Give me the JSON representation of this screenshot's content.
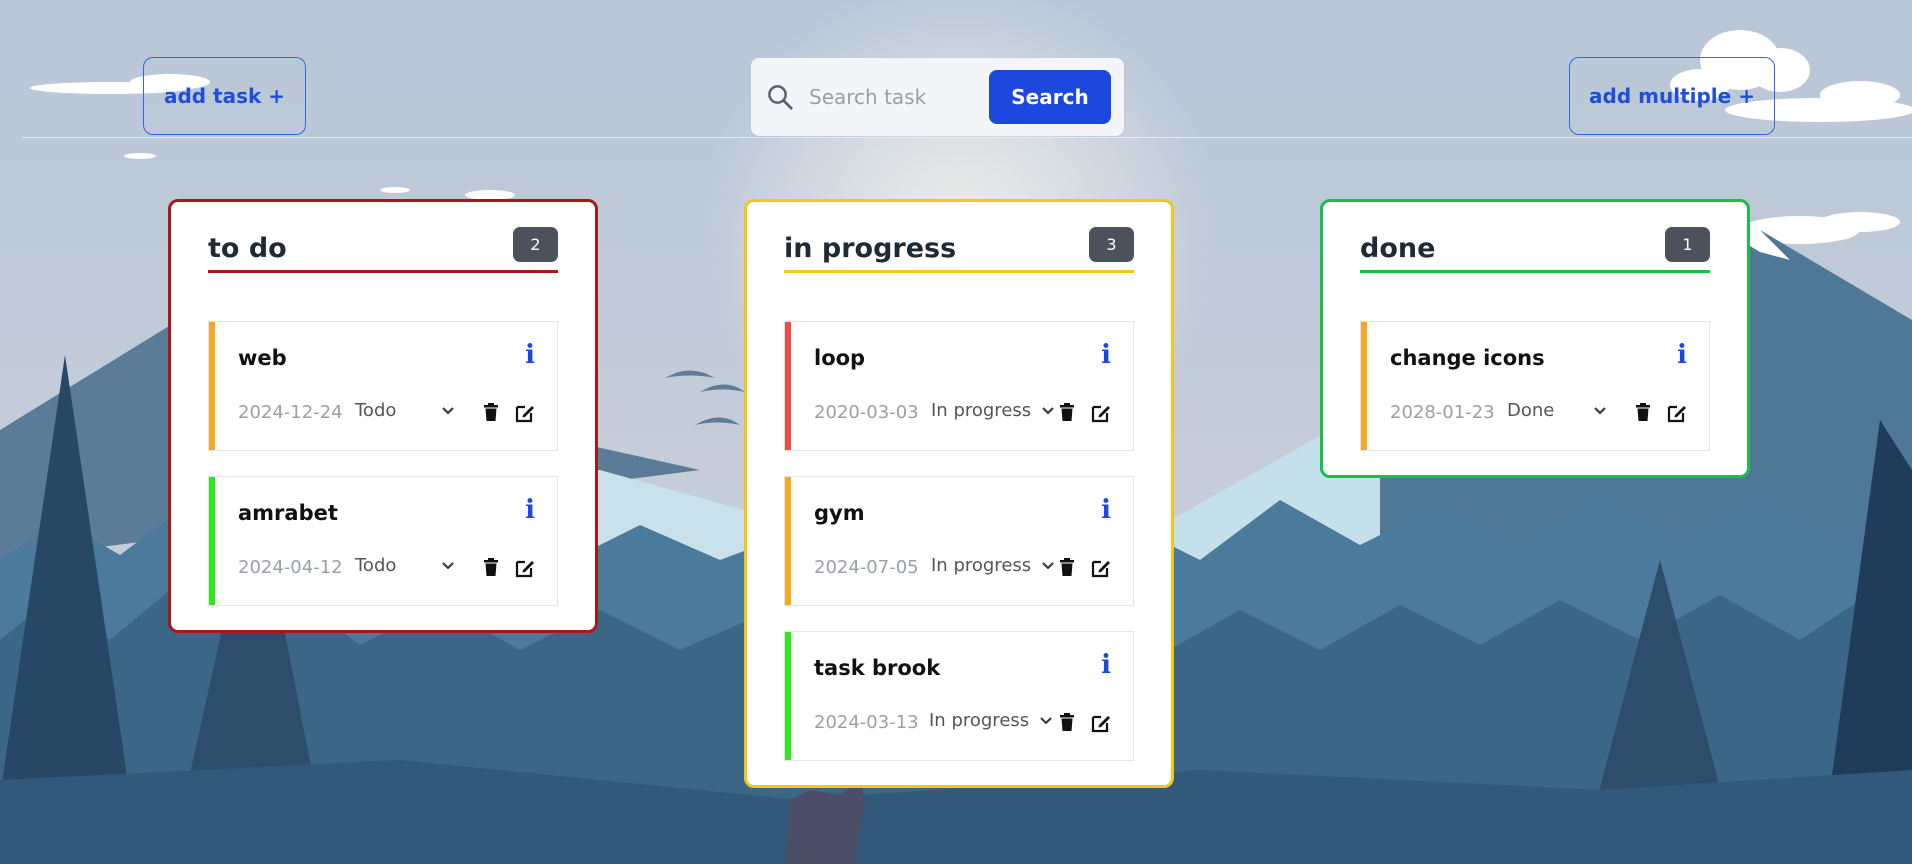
{
  "header": {
    "add_task_label": "add task +",
    "add_multiple_label": "add multiple +",
    "search_placeholder": "Search task",
    "search_button_label": "Search"
  },
  "colors": {
    "todo": "#a81818",
    "in_progress": "#f5c518",
    "done": "#18c04a",
    "accent": "#1d48de",
    "priority_orange": "#f5a623",
    "priority_red": "#ee4b4b",
    "priority_green": "#2ee61a"
  },
  "columns": [
    {
      "title": "to do",
      "count": "2",
      "tasks": [
        {
          "title": "web",
          "date": "2024-12-24",
          "status": "Todo",
          "priority_color": "#f5a623"
        },
        {
          "title": "amrabet",
          "date": "2024-04-12",
          "status": "Todo",
          "priority_color": "#2ee61a"
        }
      ]
    },
    {
      "title": "in progress",
      "count": "3",
      "tasks": [
        {
          "title": "loop",
          "date": "2020-03-03",
          "status": "In progress",
          "priority_color": "#ee4b4b"
        },
        {
          "title": "gym",
          "date": "2024-07-05",
          "status": "In progress",
          "priority_color": "#f5a623"
        },
        {
          "title": "task brook",
          "date": "2024-03-13",
          "status": "In progress",
          "priority_color": "#2ee61a"
        }
      ]
    },
    {
      "title": "done",
      "count": "1",
      "tasks": [
        {
          "title": "change icons",
          "date": "2028-01-23",
          "status": "Done",
          "priority_color": "#f5a623"
        }
      ]
    }
  ],
  "icons": {
    "search": "search-icon",
    "info": "info-icon",
    "trash": "trash-icon",
    "edit": "edit-icon",
    "dropdown": "chevron-down-icon"
  }
}
